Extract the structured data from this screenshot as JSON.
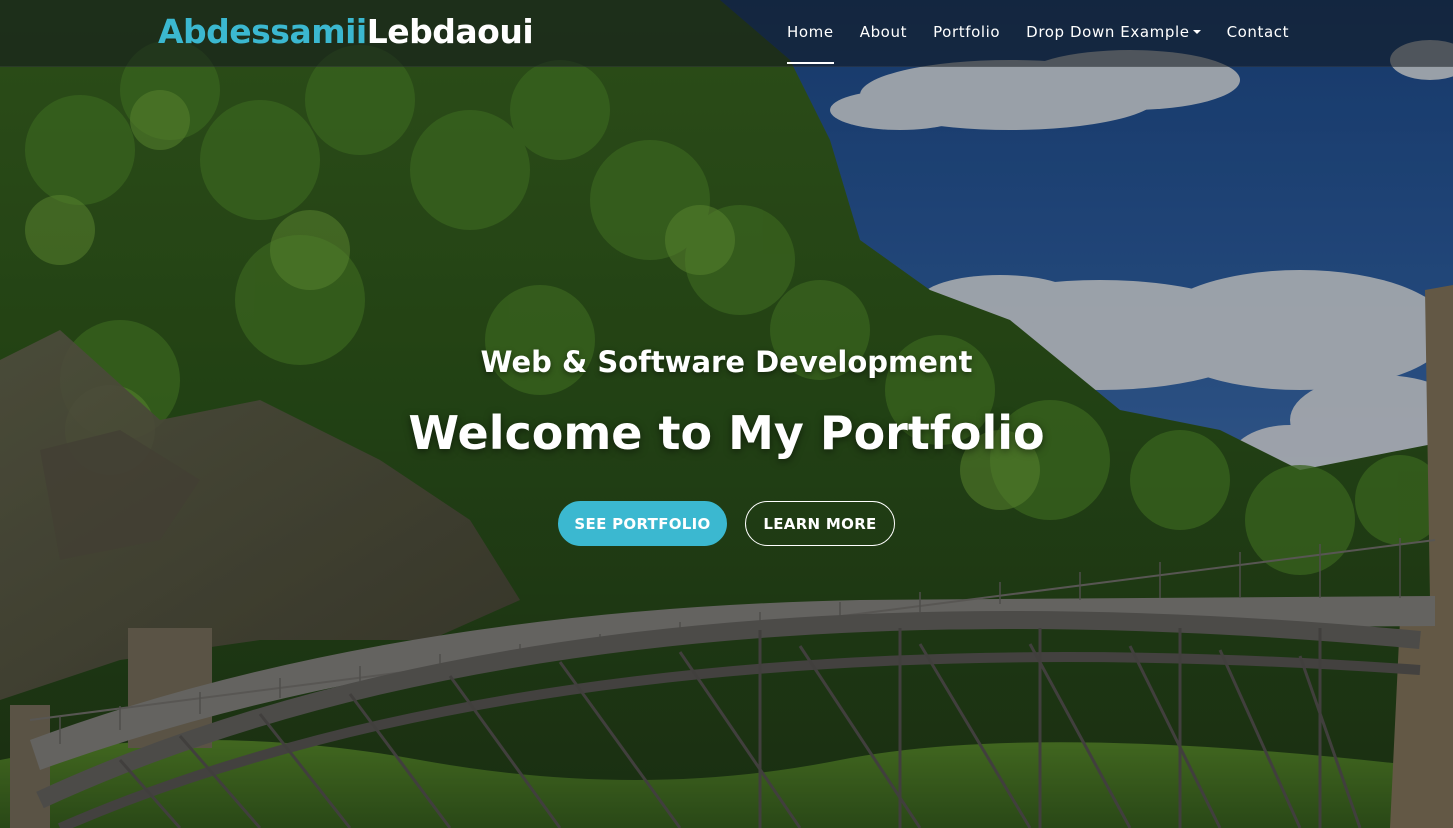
{
  "brand": {
    "first": "Abdessamii",
    "last": "Lebdaoui"
  },
  "nav": {
    "home": "Home",
    "about": "About",
    "portfolio": "Portfolio",
    "dropdown": "Drop Down Example",
    "contact": "Contact"
  },
  "hero": {
    "subtitle": "Web & Software Development",
    "title": "Welcome to My Portfolio",
    "primary_button": "SEE PORTFOLIO",
    "secondary_button": "LEARN MORE"
  },
  "colors": {
    "accent": "#3bb8d0",
    "nav_background": "rgba(18,24,30,0.55)",
    "text": "#ffffff"
  },
  "icons": {
    "dropdown": "caret-down-icon"
  }
}
